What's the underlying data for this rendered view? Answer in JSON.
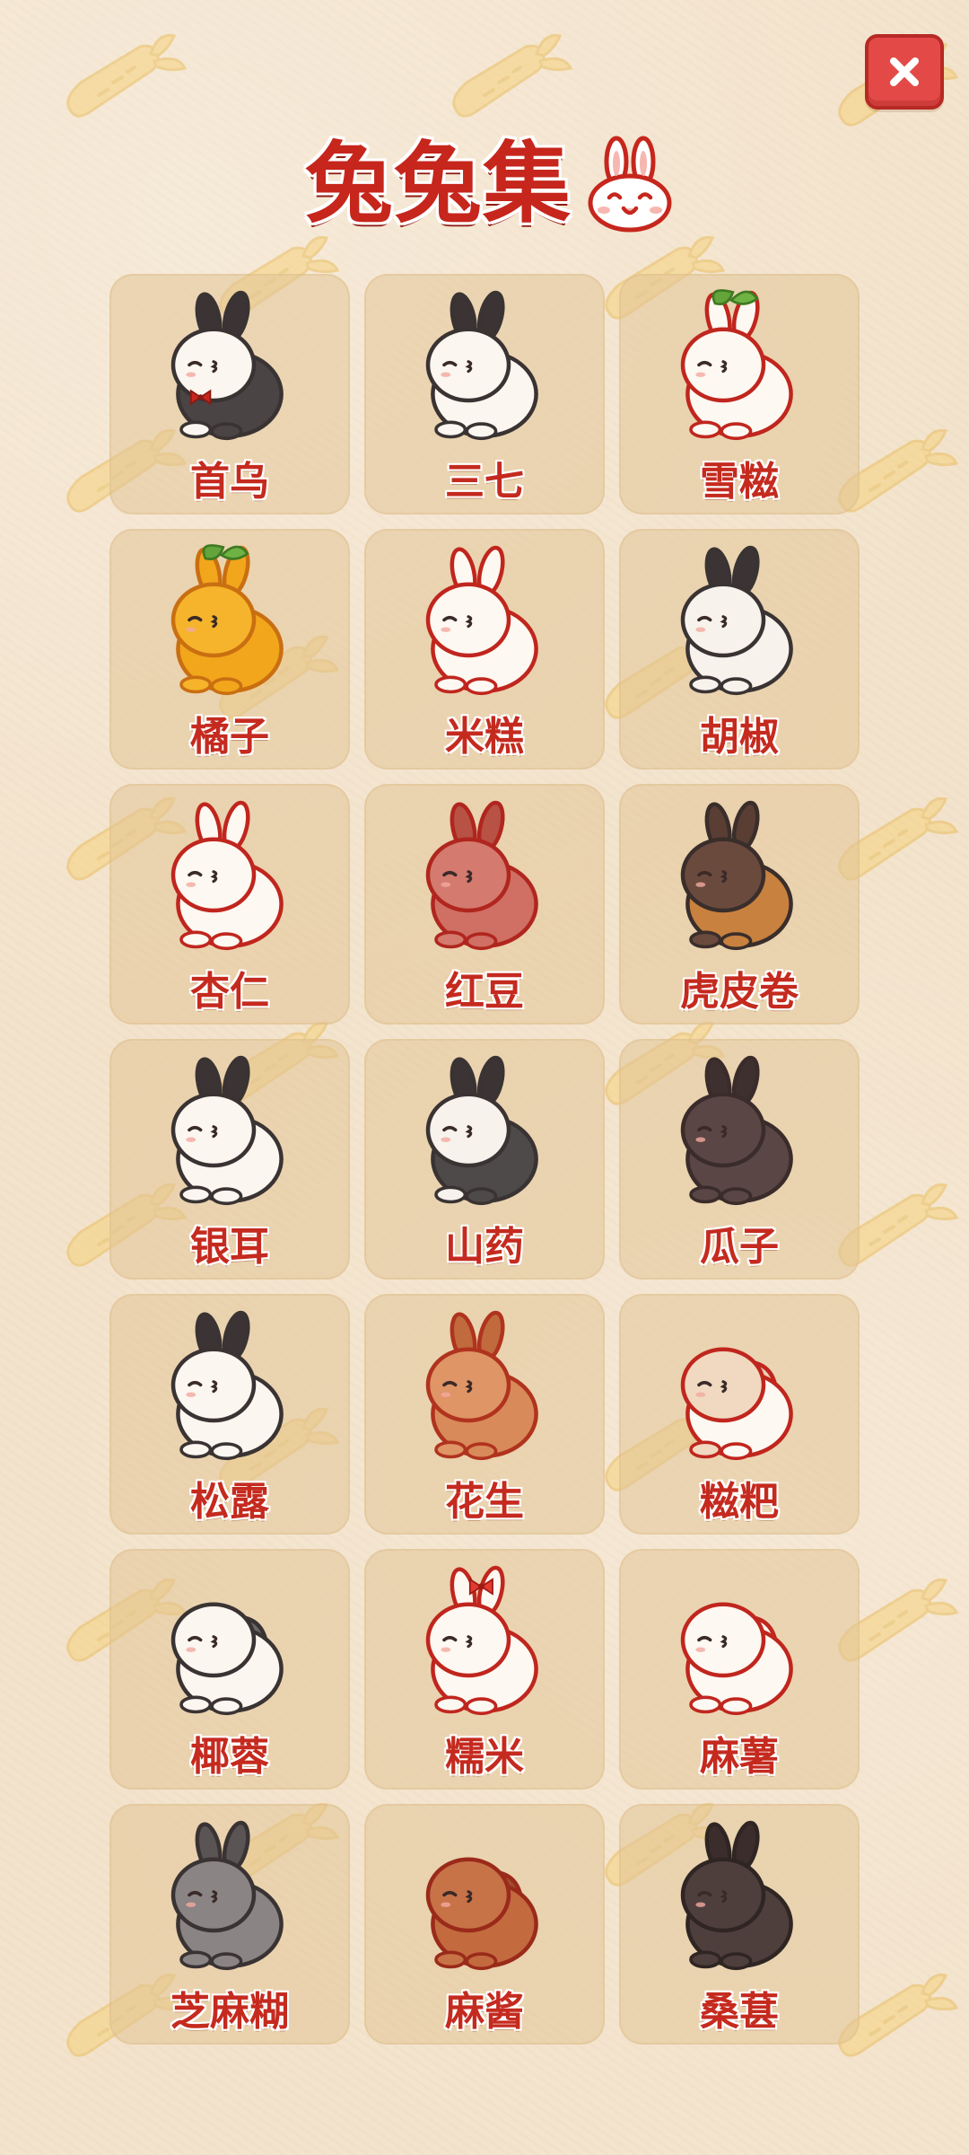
{
  "header": {
    "title": "兔兔集",
    "close_icon": "close-x-icon"
  },
  "colors": {
    "background": "#f3e3cc",
    "accent": "#c6261c",
    "card": "#e2c496",
    "close_button": "#e34a47"
  },
  "bunnies": [
    {
      "name": "首乌",
      "fur": "#4a4444",
      "belly": "#fbf6ef",
      "outline": "#3a3333",
      "ear": "#3c3434",
      "accessory": "bowtie"
    },
    {
      "name": "三七",
      "fur": "#fbf6ef",
      "belly": "#fbf6ef",
      "outline": "#3a3333",
      "ear": "#3c3434",
      "accessory": "none"
    },
    {
      "name": "雪糍",
      "fur": "#fdf8f1",
      "belly": "#fdf8f1",
      "outline": "#c0261e",
      "ear": "#fdf8f1",
      "accessory": "leaf"
    },
    {
      "name": "橘子",
      "fur": "#f2a61c",
      "belly": "#f5b42b",
      "outline": "#c96f11",
      "ear": "#f2a61c",
      "accessory": "leaf"
    },
    {
      "name": "米糕",
      "fur": "#fdf8f1",
      "belly": "#fdf8f1",
      "outline": "#c0261e",
      "ear": "#fdf8f1",
      "accessory": "none"
    },
    {
      "name": "胡椒",
      "fur": "#f7f2ec",
      "belly": "#f7f2ec",
      "outline": "#3a3333",
      "ear": "#3c3434",
      "accessory": "none"
    },
    {
      "name": "杏仁",
      "fur": "#fdf8f1",
      "belly": "#fdf8f1",
      "outline": "#c0261e",
      "ear": "#fdf8f1",
      "accessory": "none"
    },
    {
      "name": "红豆",
      "fur": "#d06f64",
      "belly": "#d47a6f",
      "outline": "#b0261e",
      "ear": "#b75245",
      "accessory": "none"
    },
    {
      "name": "虎皮卷",
      "fur": "#c8813f",
      "belly": "#6b4a3e",
      "outline": "#3a2e2b",
      "ear": "#5a3e34",
      "accessory": "none"
    },
    {
      "name": "银耳",
      "fur": "#fbf6ef",
      "belly": "#fbf6ef",
      "outline": "#3a3333",
      "ear": "#3c3434",
      "accessory": "none"
    },
    {
      "name": "山药",
      "fur": "#4f4a4a",
      "belly": "#f7f2ec",
      "outline": "#3a3333",
      "ear": "#3c3434",
      "accessory": "none"
    },
    {
      "name": "瓜子",
      "fur": "#5a4644",
      "belly": "#5a4644",
      "outline": "#3a2c2a",
      "ear": "#3e302e",
      "accessory": "none"
    },
    {
      "name": "松露",
      "fur": "#fbf6ef",
      "belly": "#fbf6ef",
      "outline": "#3a3333",
      "ear": "#3c3434",
      "accessory": "none"
    },
    {
      "name": "花生",
      "fur": "#d98a5a",
      "belly": "#df9566",
      "outline": "#b0331e",
      "ear": "#c06a3e",
      "accessory": "none"
    },
    {
      "name": "糍粑",
      "fur": "#fdf8f1",
      "belly": "#f0d9c0",
      "outline": "#c0261e",
      "ear": "#e9cfb3",
      "accessory": "lop"
    },
    {
      "name": "椰蓉",
      "fur": "#fbf6ef",
      "belly": "#fbf6ef",
      "outline": "#3a3333",
      "ear": "#6d6868",
      "accessory": "lop"
    },
    {
      "name": "糯米",
      "fur": "#fdf8f1",
      "belly": "#fdf8f1",
      "outline": "#c0261e",
      "ear": "#fdf8f1",
      "accessory": "bow"
    },
    {
      "name": "麻薯",
      "fur": "#fdf8f1",
      "belly": "#fdf8f1",
      "outline": "#c0261e",
      "ear": "#fdf8f1",
      "accessory": "lop"
    },
    {
      "name": "芝麻糊",
      "fur": "#8a8484",
      "belly": "#8a8484",
      "outline": "#3a3333",
      "ear": "#5a5454",
      "accessory": "none"
    },
    {
      "name": "麻酱",
      "fur": "#c36a3f",
      "belly": "#c87248",
      "outline": "#9a2a1a",
      "ear": "#9e4e2e",
      "accessory": "lop"
    },
    {
      "name": "桑葚",
      "fur": "#4e3f3d",
      "belly": "#4e3f3d",
      "outline": "#2f2523",
      "ear": "#3a2d2b",
      "accessory": "none"
    }
  ]
}
